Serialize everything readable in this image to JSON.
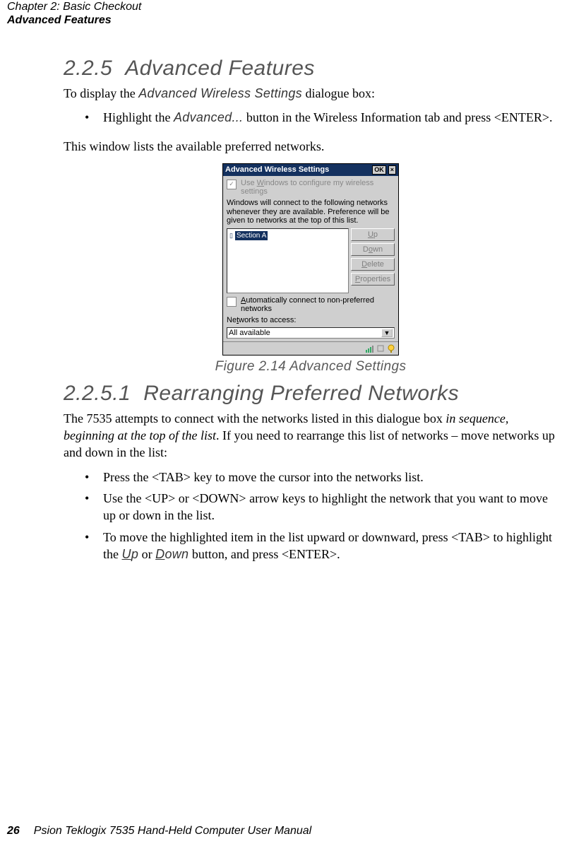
{
  "header": {
    "chapter": "Chapter  2:  Basic Checkout",
    "section": "Advanced Features"
  },
  "section225": {
    "number": "2.2.5",
    "title": "Advanced  Features",
    "intro_prefix": "To display the ",
    "intro_ui": "Advanced Wireless Settings",
    "intro_suffix": " dialogue box:",
    "bullet_prefix": "Highlight the ",
    "bullet_ui": "Advanced...",
    "bullet_suffix": " button in the Wireless Information tab and press <ENTER>.",
    "after": "This window lists the available preferred networks."
  },
  "dialog": {
    "title": "Advanced Wireless Settings",
    "ok": "OK",
    "close": "×",
    "cb1_a": "Use ",
    "cb1_u": "W",
    "cb1_b": "indows to configure my wireless settings",
    "info": "Windows will connect to the following networks whenever they are available. Preference will be given to networks at the top of this list.",
    "network_item": "Section A",
    "btn_up_u": "U",
    "btn_up": "p",
    "btn_down_u": "o",
    "btn_down_a": "D",
    "btn_down_b": "wn",
    "btn_del_u": "D",
    "btn_del": "elete",
    "btn_prop_u": "P",
    "btn_prop": "roperties",
    "cb2_u": "A",
    "cb2": "utomatically connect to non-preferred networks",
    "net_a": "Ne",
    "net_u": "t",
    "net_b": "works to access:",
    "select_val": "All available"
  },
  "fig_caption": "Figure 2.14 Advanced Settings",
  "section2251": {
    "number": "2.2.5.1",
    "title": "Rearranging  Preferred  Networks",
    "p_a": "The 7535 attempts to connect with the networks listed in this dialogue box ",
    "p_i": "in sequence, beginning at the top of the list",
    "p_b": ". If you need to rearrange this list of networks – move networks up and down in the list:",
    "b1": "Press the <TAB> key to move the cursor into the networks list.",
    "b2": "Use the <UP> or <DOWN> arrow keys to highlight the network that you want to move up or down in the list.",
    "b3_a": "To move the highlighted item in the list upward or downward, press <TAB> to highlight the ",
    "b3_up_u": "U",
    "b3_up": "p",
    "b3_or": " or ",
    "b3_dn_u": "D",
    "b3_dn": "own",
    "b3_b": " button, and press <ENTER>."
  },
  "footer": {
    "page": "26",
    "title": "Psion Teklogix 7535 Hand-Held Computer User Manual"
  }
}
